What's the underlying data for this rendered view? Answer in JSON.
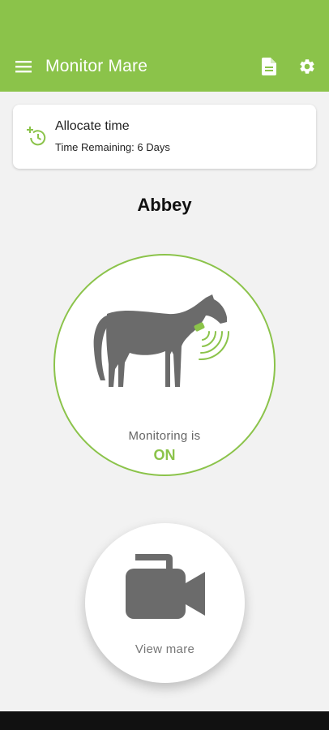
{
  "app": {
    "title": "Monitor Mare",
    "accent_color": "#8bc34a"
  },
  "toolbar": {
    "menu_icon": "hamburger-menu-icon",
    "document_icon": "document-icon",
    "settings_icon": "gear-icon"
  },
  "allocate_card": {
    "icon": "add-time-clock-icon",
    "label": "Allocate time",
    "remaining_text": "Time Remaining: 6 Days"
  },
  "mare": {
    "name": "Abbey"
  },
  "monitor": {
    "icon": "horse-with-signal-icon",
    "status_label": "Monitoring is",
    "status_value": "ON"
  },
  "view_button": {
    "icon": "video-camera-icon",
    "label": "View mare"
  }
}
